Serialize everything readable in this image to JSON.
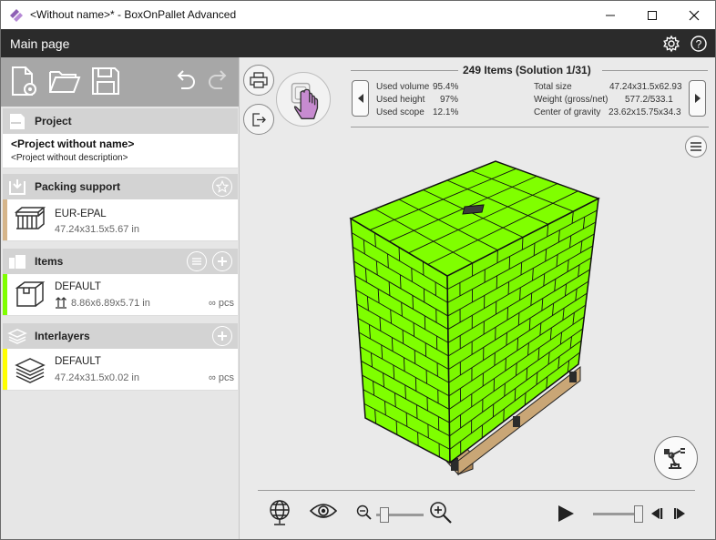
{
  "window": {
    "title": "<Without name>* - BoxOnPallet Advanced",
    "minimize_glyph": "—",
    "maximize_glyph": "☐",
    "close_glyph": "✕"
  },
  "header": {
    "title": "Main page",
    "icons": [
      "gear-icon",
      "help-icon"
    ]
  },
  "toolbar": {
    "icons": [
      "new-project-icon",
      "open-folder-icon",
      "save-icon",
      "undo-icon",
      "redo-icon"
    ]
  },
  "project": {
    "section_label": "Project",
    "name": "<Project without name>",
    "description": "<Project without description>"
  },
  "packing_support": {
    "section_label": "Packing support",
    "name": "EUR-EPAL",
    "dimensions": "47.24x31.5x5.67 in",
    "stripe_color": "#d6b58a"
  },
  "items": {
    "section_label": "Items",
    "name": "DEFAULT",
    "dimensions": "8.86x6.89x5.71 in",
    "quantity": "∞ pcs",
    "stripe_color": "#7fff00"
  },
  "interlayers": {
    "section_label": "Interlayers",
    "name": "DEFAULT",
    "dimensions": "47.24x31.5x0.02 in",
    "quantity": "∞ pcs",
    "stripe_color": "#ffff00"
  },
  "stats": {
    "title": "249 Items (Solution 1/31)",
    "used_volume_label": "Used volume",
    "used_volume_value": "95.4%",
    "used_height_label": "Used height",
    "used_height_value": "97%",
    "used_scope_label": "Used scope",
    "used_scope_value": "12.1%",
    "total_size_label": "Total size",
    "total_size_value": "47.24x31.5x62.93",
    "weight_label": "Weight (gross/net)",
    "weight_value": "577.2/533.1",
    "cog_label": "Center of gravity",
    "cog_value": "23.62x15.75x34.3"
  },
  "colors": {
    "box_green": "#7fff00",
    "box_outline": "#111111",
    "pallet_wood": "#d6b58a",
    "header_dark": "#2b2b2b",
    "cursor_purple": "#c78bd0"
  },
  "zoom_level": 0.1,
  "playback_position": 1.0
}
